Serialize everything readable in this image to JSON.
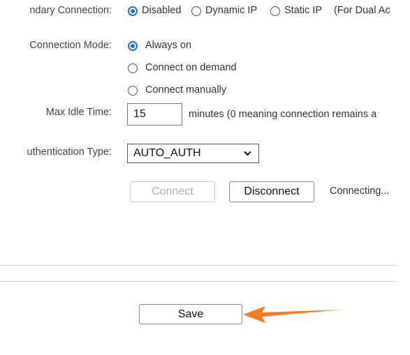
{
  "secondary_connection": {
    "label": "ndary Connection:",
    "options": [
      {
        "label": "Disabled",
        "selected": true
      },
      {
        "label": "Dynamic IP",
        "selected": false
      },
      {
        "label": "Static IP",
        "selected": false
      }
    ],
    "note": "(For Dual Ac"
  },
  "connection_mode": {
    "label": "Connection Mode:",
    "options": [
      {
        "label": "Always on",
        "selected": true
      },
      {
        "label": "Connect on demand",
        "selected": false
      },
      {
        "label": "Connect manually",
        "selected": false
      }
    ]
  },
  "max_idle_time": {
    "label": "Max Idle Time:",
    "value": "15",
    "hint": "minutes (0 meaning connection remains a"
  },
  "authentication_type": {
    "label": "uthentication Type:",
    "selected": "AUTO_AUTH"
  },
  "actions": {
    "connect_label": "Connect",
    "disconnect_label": "Disconnect",
    "status": "Connecting..."
  },
  "footer": {
    "save_label": "Save"
  },
  "colors": {
    "radio_accent": "#1a73e8",
    "arrow": "#f47c20"
  }
}
